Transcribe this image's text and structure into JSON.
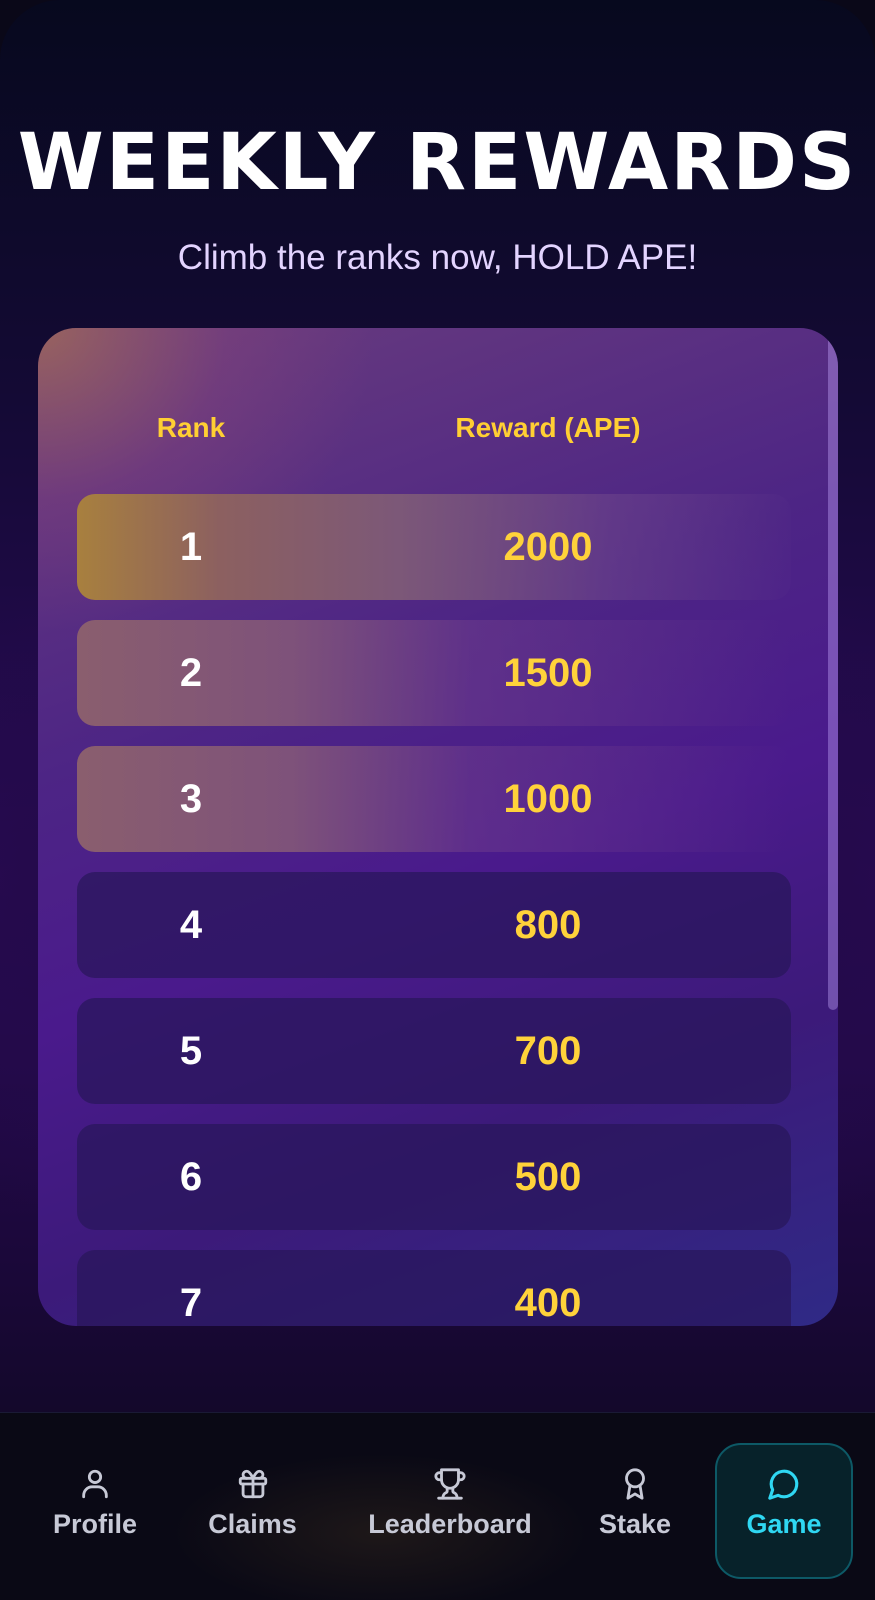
{
  "header": {
    "title": "WEEKLY REWARDS",
    "subtitle": "Climb the ranks now, HOLD APE!"
  },
  "table": {
    "columns": [
      "Rank",
      "Reward (APE)"
    ],
    "rows": [
      {
        "rank": "1",
        "reward": "2000"
      },
      {
        "rank": "2",
        "reward": "1500"
      },
      {
        "rank": "3",
        "reward": "1000"
      },
      {
        "rank": "4",
        "reward": "800"
      },
      {
        "rank": "5",
        "reward": "700"
      },
      {
        "rank": "6",
        "reward": "500"
      },
      {
        "rank": "7",
        "reward": "400"
      }
    ]
  },
  "nav": {
    "items": [
      {
        "label": "Profile",
        "icon": "user-icon"
      },
      {
        "label": "Claims",
        "icon": "gift-icon"
      },
      {
        "label": "Leaderboard",
        "icon": "trophy-icon"
      },
      {
        "label": "Stake",
        "icon": "award-icon"
      },
      {
        "label": "Game",
        "icon": "chat-bubble-icon",
        "active": true
      }
    ]
  },
  "colors": {
    "accent_gold": "#ffd23a",
    "active_cyan": "#2fd7f2",
    "background": "#0a0818"
  }
}
